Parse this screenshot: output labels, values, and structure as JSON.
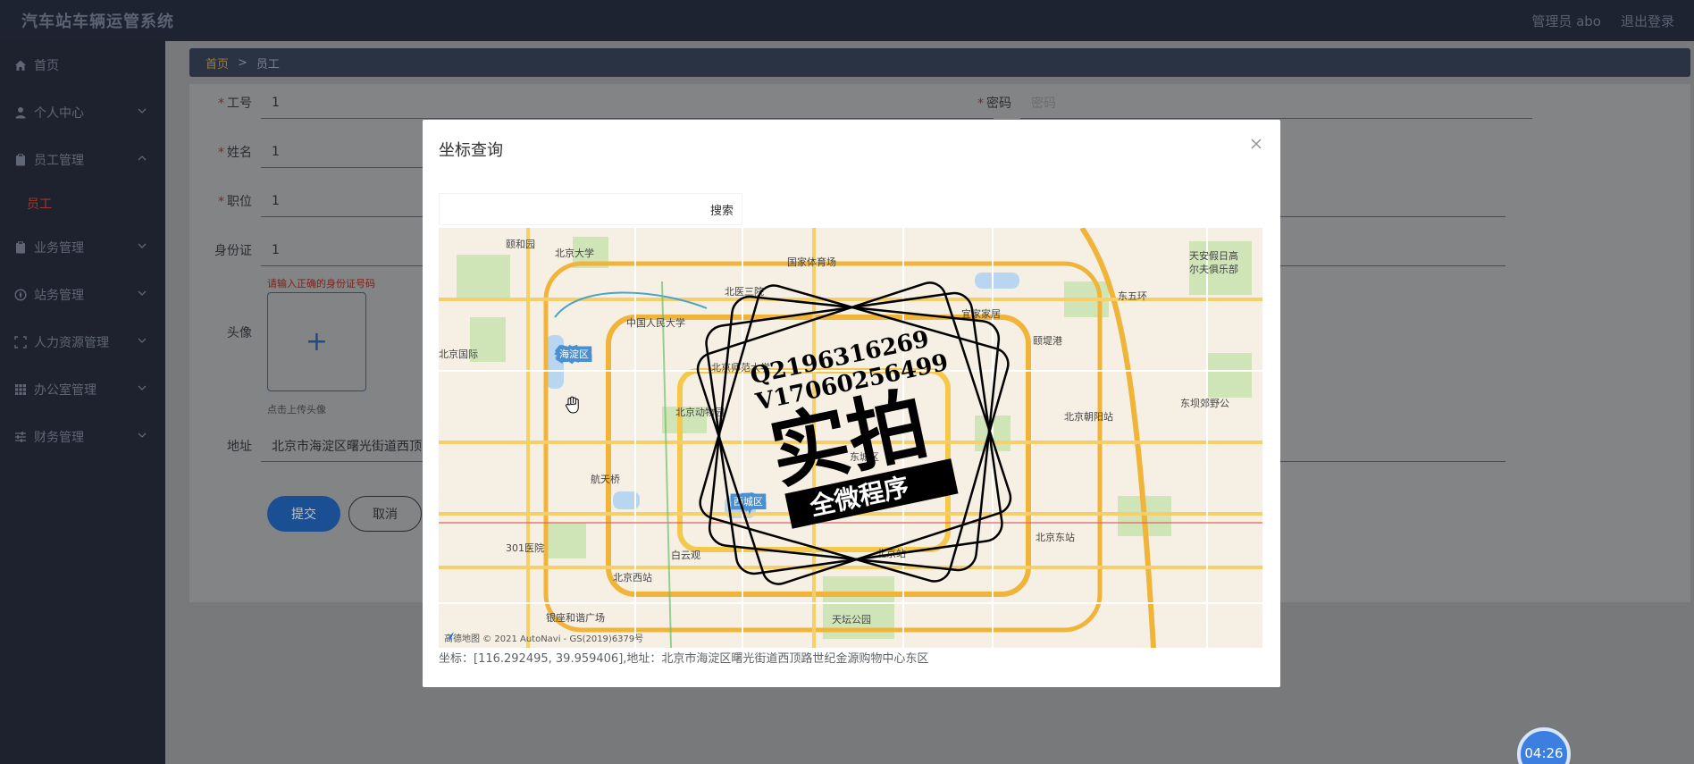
{
  "app": {
    "title": "汽车站车辆运管系统"
  },
  "header": {
    "user": "管理员 abo",
    "logout": "退出登录"
  },
  "sidebar": {
    "items": [
      {
        "label": "首页",
        "icon": "home-icon"
      },
      {
        "label": "个人中心",
        "icon": "user-icon"
      },
      {
        "label": "员工管理",
        "icon": "clipboard-icon",
        "expanded": true,
        "children": [
          {
            "label": "员工"
          }
        ]
      },
      {
        "label": "业务管理",
        "icon": "clipboard-icon"
      },
      {
        "label": "站务管理",
        "icon": "compass-icon"
      },
      {
        "label": "人力资源管理",
        "icon": "frame-icon"
      },
      {
        "label": "办公室管理",
        "icon": "grid-icon"
      },
      {
        "label": "财务管理",
        "icon": "sliders-icon"
      }
    ]
  },
  "breadcrumb": {
    "home": "首页",
    "separator": ">",
    "current": "员工"
  },
  "form": {
    "employee_id": {
      "label": "工号",
      "value": "1"
    },
    "password": {
      "label": "密码",
      "placeholder": "密码"
    },
    "name": {
      "label": "姓名",
      "value": "1"
    },
    "position": {
      "label": "职位",
      "value": "1"
    },
    "id_card": {
      "label": "身份证",
      "value": "1",
      "error": "请输入正确的身份证号码"
    },
    "avatar": {
      "label": "头像",
      "tip": "点击上传头像",
      "plus": "+"
    },
    "address": {
      "label": "地址",
      "value": "北京市海淀区曙光街道西顶"
    },
    "submit": "提交",
    "cancel": "取消"
  },
  "dialog": {
    "title": "坐标查询",
    "search_button": "搜索",
    "search_placeholder": "",
    "map_copyright": "高德地图 © 2021 AutoNavi - GS(2019)6379号",
    "coordinate_text": "坐标：[116.292495, 39.959406],地址：北京市海淀区曙光街道西顶路世纪金源购物中心东区",
    "map_labels": [
      "颐和园",
      "北京大学",
      "国家体育场",
      "北医三院",
      "中国人民大学",
      "海淀区",
      "北京师范大学",
      "北京动物园",
      "北京国际",
      "航天桥",
      "301医院",
      "白云观",
      "北京西站",
      "银座和谐广场",
      "天坛公园",
      "北京站",
      "北京东站",
      "北京朝阳站",
      "颐堤港",
      "宜家家居",
      "东坝郊野公",
      "天安假日高尔夫俱乐部",
      "西城区",
      "东城区",
      "东五环"
    ],
    "watermark": {
      "line1": "Q2196316269",
      "line2": "V17060256499",
      "big": "实拍",
      "banner": "全微程序"
    }
  },
  "timer": {
    "value": "04:26"
  },
  "colors": {
    "header_bg": "#1d2330",
    "sidebar_bg": "#1d222e",
    "accent": "#1b4f93",
    "error": "#7a231c"
  }
}
